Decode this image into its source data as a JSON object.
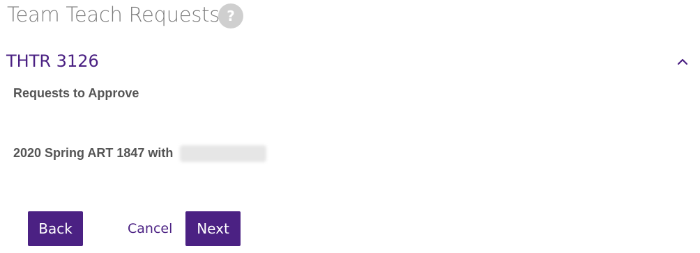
{
  "header": {
    "title": "Team Teach Requests",
    "help_icon": "question-circle-icon",
    "help_glyph": "?"
  },
  "section": {
    "title": "THTR 3126",
    "collapse_icon": "chevron-up-icon",
    "subheading": "Requests to Approve",
    "requests": [
      {
        "label": "2020 Spring ART 1847 with"
      }
    ]
  },
  "actions": {
    "back_label": "Back",
    "cancel_label": "Cancel",
    "next_label": "Next"
  },
  "colors": {
    "accent": "#4b2183",
    "title_gray": "#7d7d7d",
    "text_gray": "#555555",
    "help_bg": "#cfcfcf"
  }
}
